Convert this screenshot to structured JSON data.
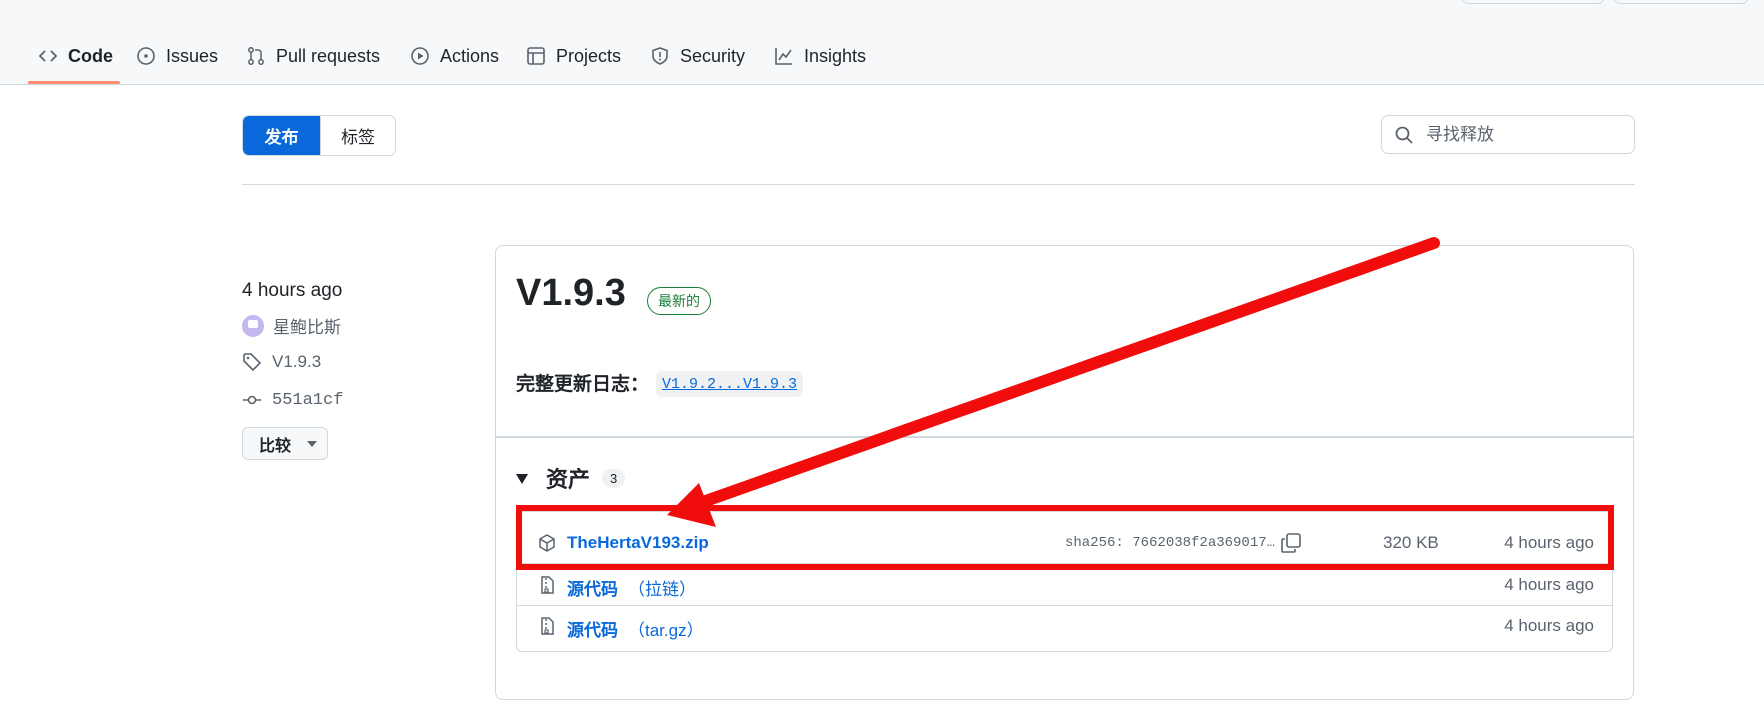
{
  "nav": {
    "tabs": [
      {
        "label": "Code",
        "icon": "code-icon"
      },
      {
        "label": "Issues",
        "icon": "issue-circle-icon"
      },
      {
        "label": "Pull requests",
        "icon": "pull-request-icon"
      },
      {
        "label": "Actions",
        "icon": "play-icon"
      },
      {
        "label": "Projects",
        "icon": "table-icon"
      },
      {
        "label": "Security",
        "icon": "shield-icon"
      },
      {
        "label": "Insights",
        "icon": "graph-icon"
      }
    ],
    "active": "Code"
  },
  "toolbar": {
    "releases_label": "发布",
    "tags_label": "标签",
    "search_placeholder": "寻找释放"
  },
  "release": {
    "time": "4 hours ago",
    "author": "星鲍比斯",
    "tag": "V1.9.3",
    "commit": "551a1cf",
    "compare_label": "比较",
    "title": "V1.9.3",
    "latest_badge": "最新的",
    "changelog_label": "完整更新日志：",
    "changelog_link": "V1.9.2...V1.9.3"
  },
  "assets": {
    "heading": "资产",
    "count": "3",
    "items": [
      {
        "name": "TheHertaV193.zip",
        "sha": "sha256: 7662038f2a369017…",
        "size": "320 KB",
        "time": "4 hours ago"
      },
      {
        "name": "源代码",
        "sub": "（拉链）",
        "time": "4 hours ago"
      },
      {
        "name": "源代码",
        "sub": "（tar.gz）",
        "time": "4 hours ago"
      }
    ]
  },
  "colors": {
    "accent": "#0969da",
    "tab_underline": "#fd8c73",
    "latest": "#1a7f37",
    "annotation": "#f20d0d"
  }
}
